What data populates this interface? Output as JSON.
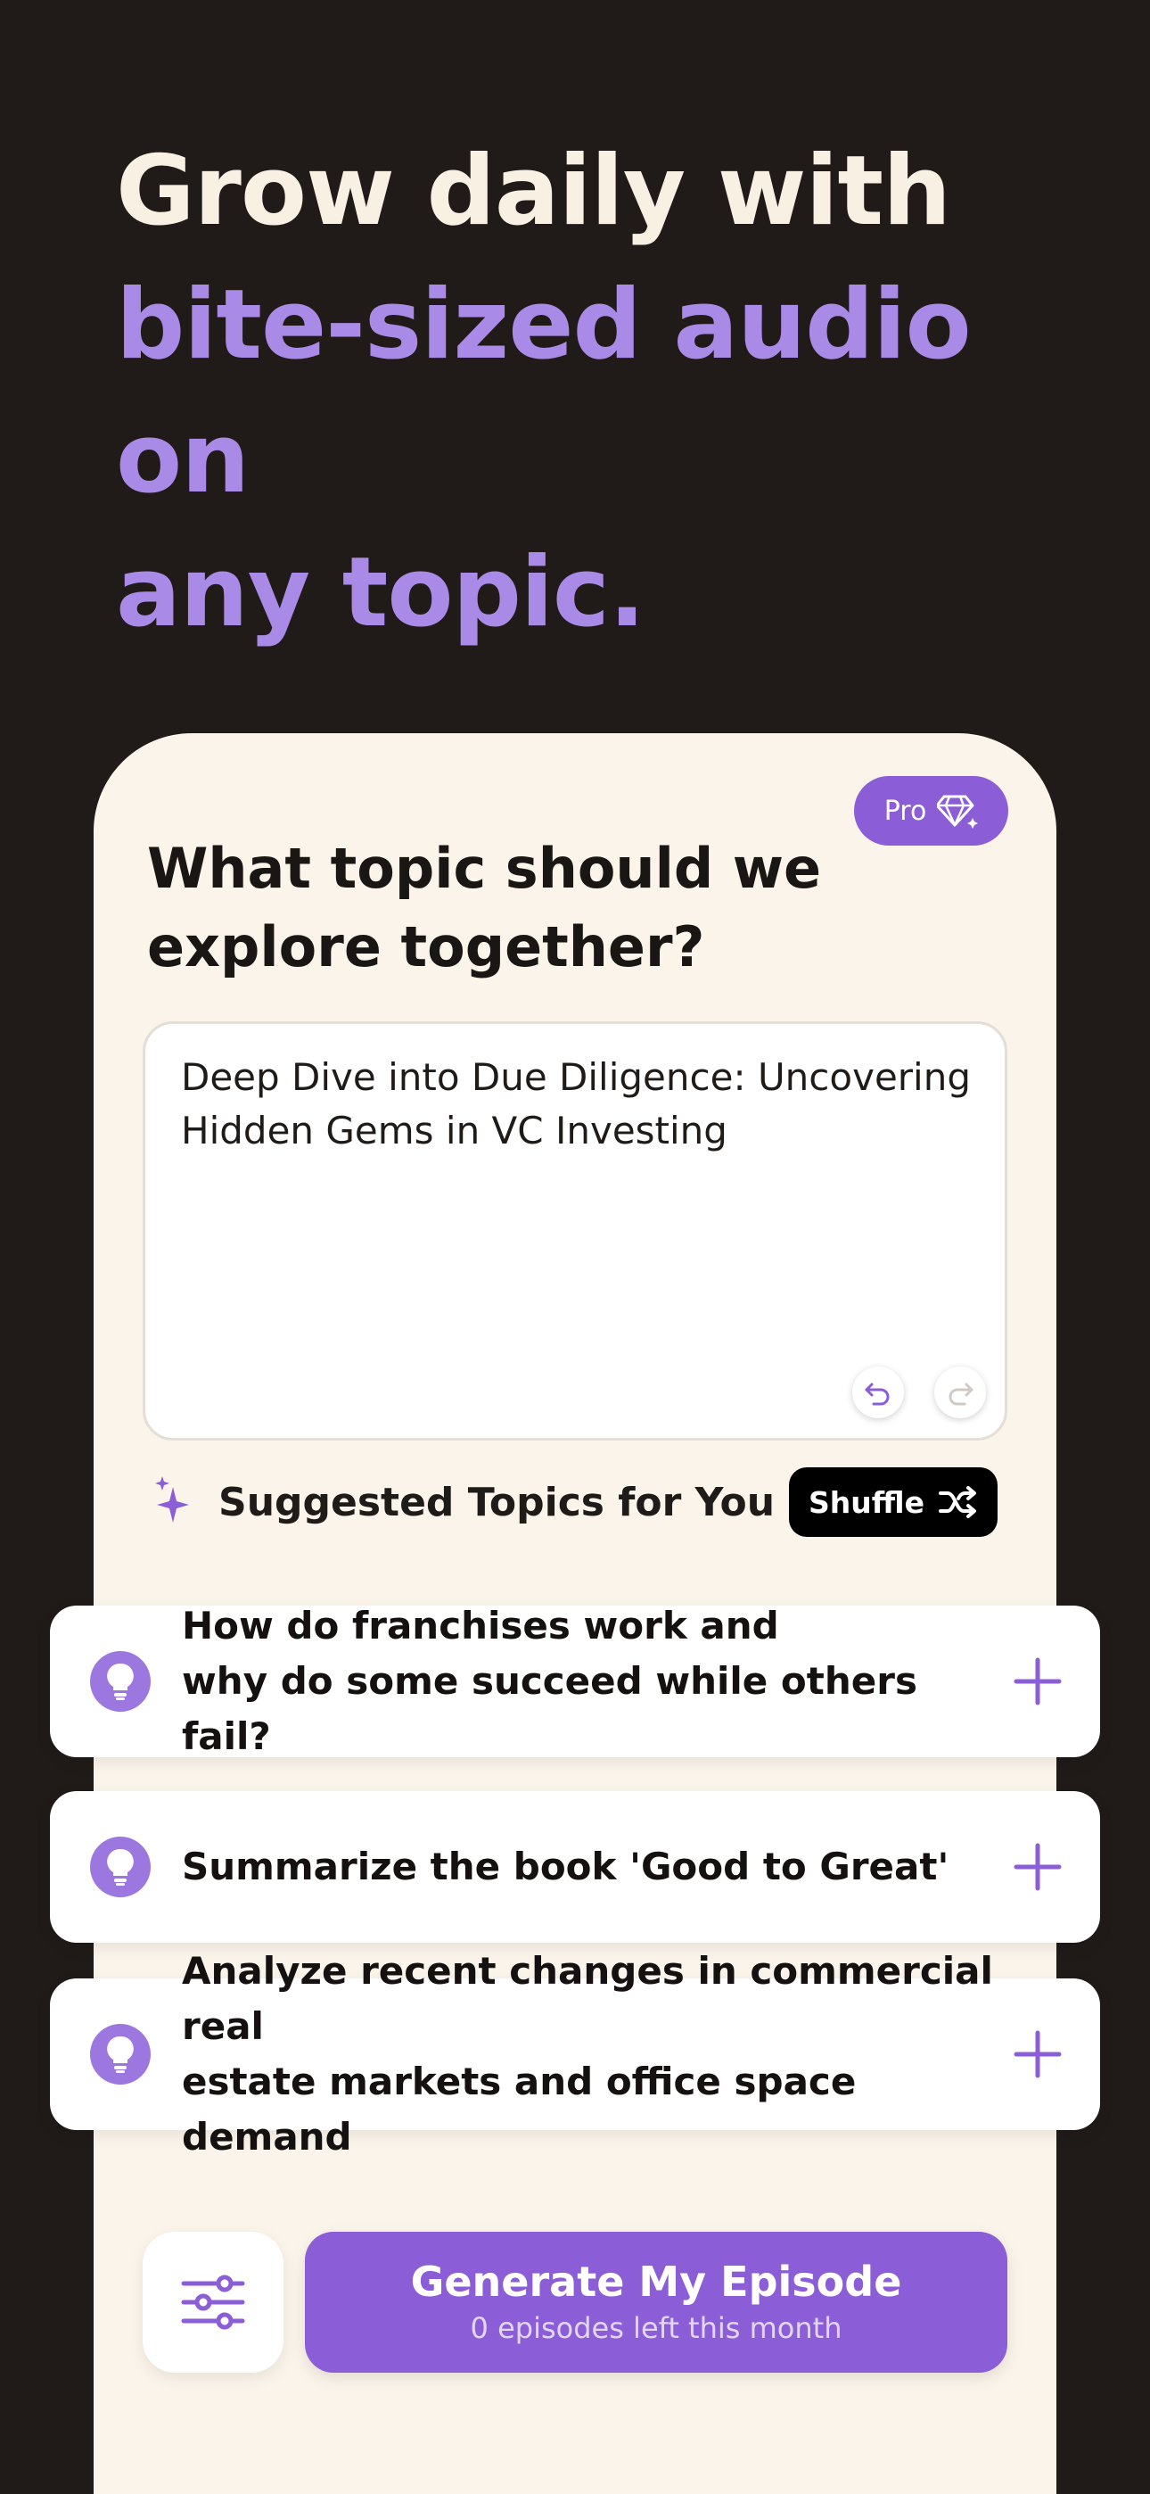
{
  "hero": {
    "line1": "Grow daily with",
    "line2": "bite-sized audio on",
    "line3": "any topic."
  },
  "badge": {
    "label": "Pro",
    "icon": "diamond-sparkle-icon"
  },
  "question": {
    "line1": "What topic should we",
    "line2": "explore together?"
  },
  "topic_input": {
    "value": "Deep Dive into Due Diligence: Uncovering Hidden Gems in VC Investing",
    "undo_icon": "undo-icon",
    "redo_icon": "redo-icon"
  },
  "suggestions": {
    "title": "Suggested Topics for You",
    "shuffle_label": "Shuffle",
    "items": [
      {
        "line1": "How do franchises work and",
        "line2": "why do some succeed while others fail?"
      },
      {
        "line1": "Summarize the book 'Good to Great'",
        "line2": ""
      },
      {
        "line1": "Analyze recent changes in commercial real",
        "line2": "estate markets and office space demand"
      }
    ]
  },
  "actions": {
    "generate_label": "Generate My Episode",
    "generate_sub": "0 episodes left this month",
    "settings_icon": "sliders-icon"
  },
  "colors": {
    "background": "#201b19",
    "card": "#faf4ea",
    "accent": "#8b5ed8",
    "hero_text": "#f7f0e3",
    "hero_accent": "#a98ae6"
  }
}
